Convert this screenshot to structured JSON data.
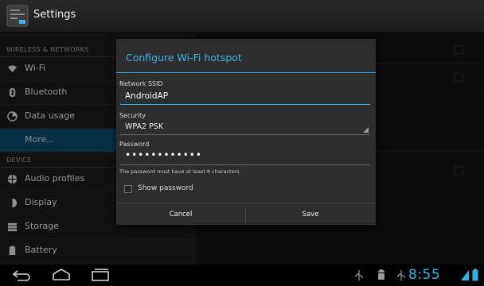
{
  "actionbar": {
    "title": "Settings",
    "icon": "settings-app-icon"
  },
  "sidebar": {
    "sections": [
      {
        "header": "WIRELESS & NETWORKS",
        "items": [
          {
            "label": "Wi-Fi",
            "icon": "wifi-icon"
          },
          {
            "label": "Bluetooth",
            "icon": "bluetooth-icon"
          },
          {
            "label": "Data usage",
            "icon": "data-usage-icon"
          },
          {
            "label": "More...",
            "icon": "",
            "selected": true
          }
        ]
      },
      {
        "header": "DEVICE",
        "items": [
          {
            "label": "Audio profiles",
            "icon": "audio-profiles-icon"
          },
          {
            "label": "Display",
            "icon": "display-icon"
          },
          {
            "label": "Storage",
            "icon": "storage-icon"
          },
          {
            "label": "Battery",
            "icon": "battery-icon"
          }
        ]
      }
    ]
  },
  "dialog": {
    "title": "Configure Wi-Fi hotspot",
    "ssid_label": "Network SSID",
    "ssid_value": "AndroidAP",
    "security_label": "Security",
    "security_value": "WPA2 PSK",
    "password_label": "Password",
    "password_value": "••••••••••••",
    "password_hint": "The password must have at least 8 characters.",
    "show_password_label": "Show password",
    "show_password_checked": false,
    "cancel_label": "Cancel",
    "save_label": "Save"
  },
  "statusbar": {
    "time": "8:55",
    "icons": [
      "usb-icon",
      "android-debug-icon",
      "usb-icon",
      "signal-icon",
      "battery-status-icon"
    ]
  },
  "navbar": {
    "icons": [
      "back-icon",
      "home-icon",
      "recent-apps-icon"
    ]
  },
  "colors": {
    "accent": "#33b5e5",
    "selected": "#0b4a6e",
    "dialog_bg": "#2d2d2d"
  }
}
